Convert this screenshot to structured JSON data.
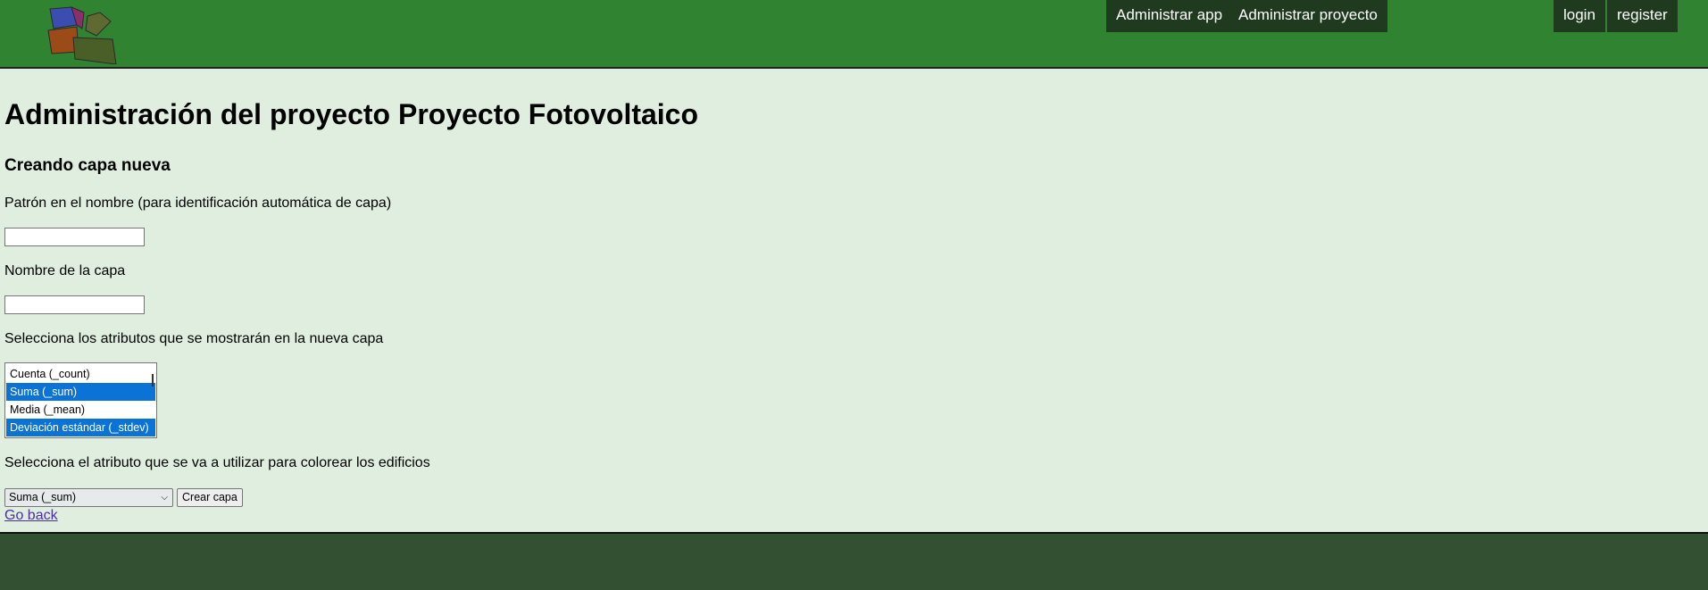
{
  "header": {
    "nav": {
      "admin_app": "Administrar app",
      "admin_project": "Administrar proyecto",
      "login": "login",
      "register": "register"
    },
    "logo_icon": "buildings-logo-icon"
  },
  "main": {
    "title": "Administración del proyecto Proyecto Fotovoltaico",
    "subtitle": "Creando capa nueva",
    "pattern_label": "Patrón en el nombre (para identificación automática de capa)",
    "pattern_value": "",
    "layer_name_label": "Nombre de la capa",
    "layer_name_value": "",
    "attributes_label": "Selecciona los atributos que se mostrarán en la nueva capa",
    "attributes": [
      {
        "label": "Cuenta (_count)",
        "selected": false
      },
      {
        "label": "Suma (_sum)",
        "selected": true
      },
      {
        "label": "Media (_mean)",
        "selected": false
      },
      {
        "label": "Deviación estándar (_stdev)",
        "selected": true
      }
    ],
    "color_label": "Selecciona el atributo que se va a utilizar para colorear los edificios",
    "color_selected": "Suma (_sum)",
    "create_button": "Crear capa",
    "go_back": "Go back"
  },
  "colors": {
    "header_bg": "#308330",
    "nav_bg": "#1f3a1f",
    "page_bg": "#e0eedf",
    "footer_bg": "#335032",
    "selection": "#0b73d6"
  }
}
